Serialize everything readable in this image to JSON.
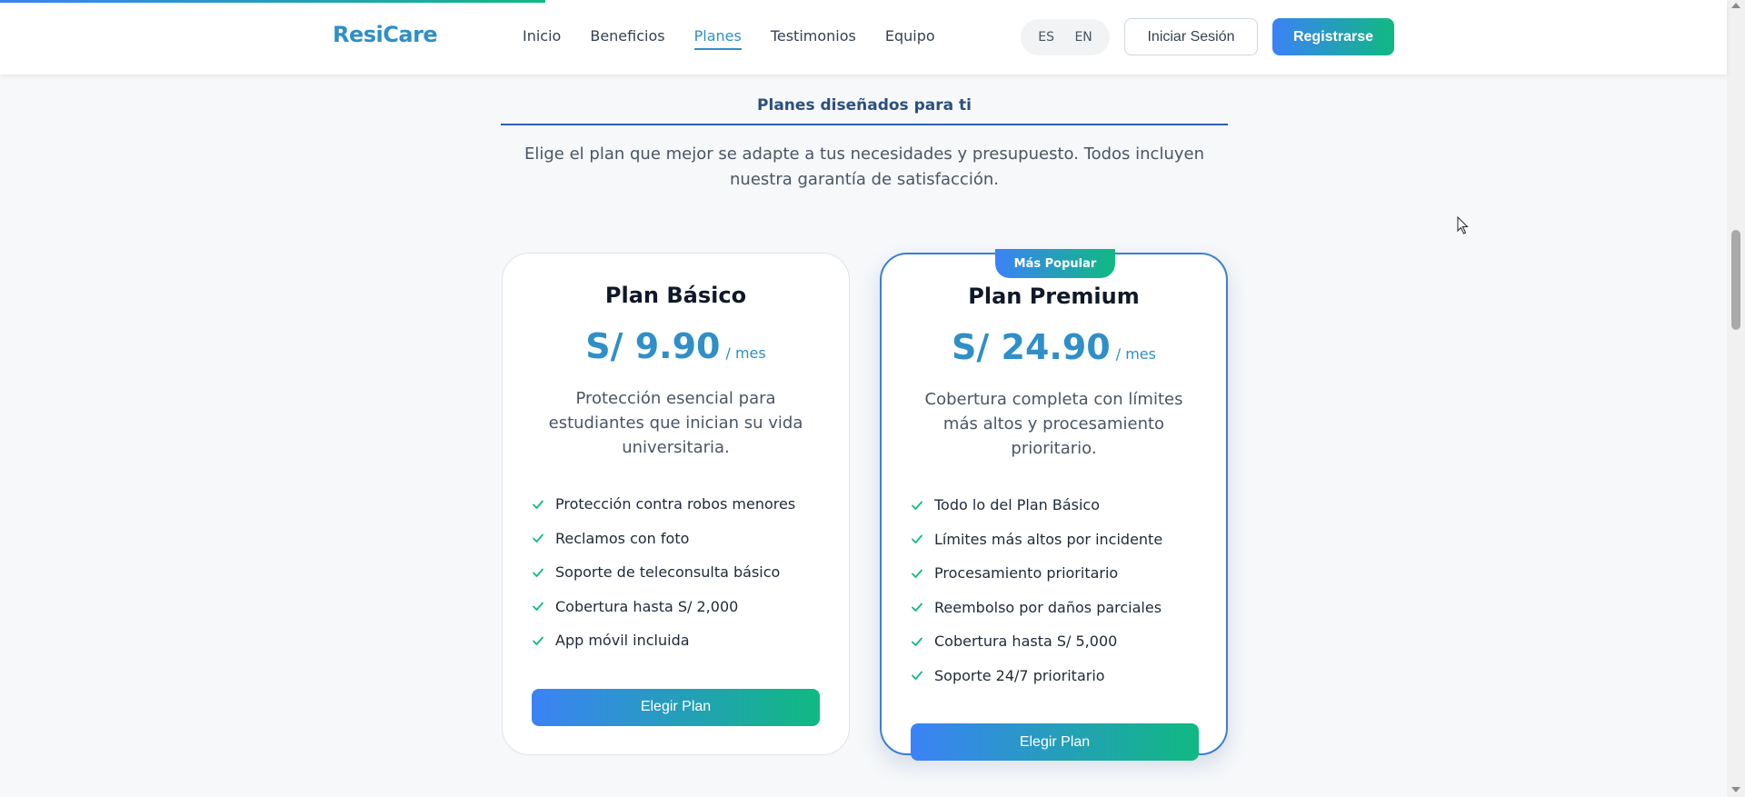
{
  "progress": {
    "value_percent": 31.6,
    "color_start": "#3b82f6",
    "color_end": "#10b981"
  },
  "header": {
    "logo": "ResiCare",
    "nav": [
      {
        "label": "Inicio",
        "active": false
      },
      {
        "label": "Beneficios",
        "active": false
      },
      {
        "label": "Planes",
        "active": true
      },
      {
        "label": "Testimonios",
        "active": false
      },
      {
        "label": "Equipo",
        "active": false
      }
    ],
    "languages": [
      "ES",
      "EN"
    ],
    "login_label": "Iniciar Sesión",
    "register_label": "Registrarse"
  },
  "section": {
    "title": "Planes diseñados para ti",
    "subtitle": "Elige el plan que mejor se adapte a tus necesidades y presupuesto. Todos incluyen nuestra garantía de satisfacción."
  },
  "plans": [
    {
      "name": "Plan Básico",
      "price": "S/ 9.90",
      "period": "/ mes",
      "description": "Protección esencial para estudiantes que inician su vida universitaria.",
      "features": [
        "Protección contra robos menores",
        "Reclamos con foto",
        "Soporte de teleconsulta básico",
        "Cobertura hasta S/ 2,000",
        "App móvil incluida"
      ],
      "button_label": "Elegir Plan"
    },
    {
      "badge": "Más Popular",
      "name": "Plan Premium",
      "price": "S/ 24.90",
      "period": "/ mes",
      "description": "Cobertura completa con límites más altos y procesamiento prioritario.",
      "features": [
        "Todo lo del Plan Básico",
        "Límites más altos por incidente",
        "Procesamiento prioritario",
        "Reembolso por daños parciales",
        "Cobertura hasta S/ 5,000",
        "Soporte 24/7 prioritario"
      ],
      "button_label": "Elegir Plan"
    }
  ],
  "colors": {
    "brand": "#2f8fc7",
    "accent_gradient_start": "#3b82f6",
    "accent_gradient_end": "#10b981",
    "check": "#10b981"
  },
  "icons": {
    "feature": "check-icon",
    "cursor": "pointer-icon"
  }
}
